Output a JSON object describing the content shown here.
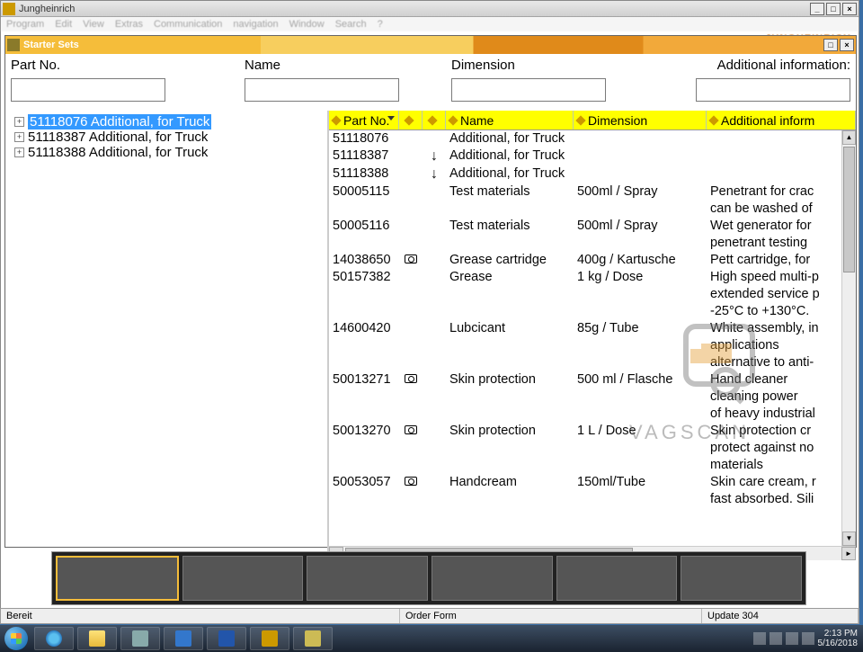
{
  "app": {
    "title": "Jungheinrich",
    "brand": "JUNGHEINRICH"
  },
  "menu": [
    "Program",
    "Edit",
    "View",
    "Extras",
    "Communication",
    "navigation",
    "Window",
    "Search",
    "?"
  ],
  "inner_title": "Starter Sets",
  "filters": {
    "part_no": {
      "label": "Part No.",
      "value": ""
    },
    "name": {
      "label": "Name",
      "value": ""
    },
    "dimension": {
      "label": "Dimension",
      "value": ""
    },
    "additional": {
      "label": "Additional information:",
      "value": ""
    }
  },
  "tree": [
    {
      "label": "51118076 Additional, for Truck",
      "selected": true
    },
    {
      "label": "51118387 Additional, for Truck",
      "selected": false
    },
    {
      "label": "51118388 Additional, for Truck",
      "selected": false
    }
  ],
  "headers": {
    "part_no": "Part No.",
    "name": "Name",
    "dimension": "Dimension",
    "additional": "Additional inform"
  },
  "rows": [
    {
      "part_no": "51118076",
      "b": "",
      "c": "",
      "name": "Additional, for Truck",
      "dimension": "",
      "info": ""
    },
    {
      "part_no": "51118387",
      "b": "",
      "c": "down",
      "name": "Additional, for Truck",
      "dimension": "",
      "info": ""
    },
    {
      "part_no": "51118388",
      "b": "",
      "c": "down",
      "name": "Additional, for Truck",
      "dimension": "",
      "info": ""
    },
    {
      "part_no": "50005115",
      "b": "",
      "c": "",
      "name": "Test materials",
      "dimension": "500ml / Spray",
      "info": "Penetrant for crac"
    },
    {
      "part_no": "",
      "b": "",
      "c": "",
      "name": "",
      "dimension": "",
      "info": "can be washed of"
    },
    {
      "part_no": "50005116",
      "b": "",
      "c": "",
      "name": "Test materials",
      "dimension": "500ml / Spray",
      "info": "Wet generator for"
    },
    {
      "part_no": "",
      "b": "",
      "c": "",
      "name": "",
      "dimension": "",
      "info": "penetrant testing"
    },
    {
      "part_no": "14038650",
      "b": "cam",
      "c": "",
      "name": "Grease cartridge",
      "dimension": "400g / Kartusche",
      "info": "Pett cartridge, for"
    },
    {
      "part_no": "50157382",
      "b": "",
      "c": "",
      "name": "Grease",
      "dimension": "1 kg / Dose",
      "info": "High speed multi-p"
    },
    {
      "part_no": "",
      "b": "",
      "c": "",
      "name": "",
      "dimension": "",
      "info": "extended service p"
    },
    {
      "part_no": "",
      "b": "",
      "c": "",
      "name": "",
      "dimension": "",
      "info": "-25°C to +130°C."
    },
    {
      "part_no": "14600420",
      "b": "",
      "c": "",
      "name": "Lubcicant",
      "dimension": "85g / Tube",
      "info": "White assembly, in"
    },
    {
      "part_no": "",
      "b": "",
      "c": "",
      "name": "",
      "dimension": "",
      "info": "applications"
    },
    {
      "part_no": "",
      "b": "",
      "c": "",
      "name": "",
      "dimension": "",
      "info": "alternative to anti-"
    },
    {
      "part_no": "50013271",
      "b": "cam",
      "c": "",
      "name": "Skin protection",
      "dimension": "500 ml / Flasche",
      "info": "Hand cleaner"
    },
    {
      "part_no": "",
      "b": "",
      "c": "",
      "name": "",
      "dimension": "",
      "info": "cleaning power"
    },
    {
      "part_no": "",
      "b": "",
      "c": "",
      "name": "",
      "dimension": "",
      "info": "of heavy industrial"
    },
    {
      "part_no": "50013270",
      "b": "cam",
      "c": "",
      "name": "Skin protection",
      "dimension": "1 L /  Dose",
      "info": "Skin protection cr"
    },
    {
      "part_no": "",
      "b": "",
      "c": "",
      "name": "",
      "dimension": "",
      "info": "protect against no"
    },
    {
      "part_no": "",
      "b": "",
      "c": "",
      "name": "",
      "dimension": "",
      "info": "materials"
    },
    {
      "part_no": "50053057",
      "b": "cam",
      "c": "",
      "name": "Handcream",
      "dimension": "150ml/Tube",
      "info": "Skin care cream, r"
    },
    {
      "part_no": "",
      "b": "",
      "c": "",
      "name": "",
      "dimension": "",
      "info": "fast absorbed. Sili"
    }
  ],
  "status": {
    "ready": "Bereit",
    "mid": "Order Form",
    "right": "Update 304"
  },
  "clock": {
    "time": "2:13 PM",
    "date": "5/16/2018"
  },
  "watermark": "VAGSCAN"
}
